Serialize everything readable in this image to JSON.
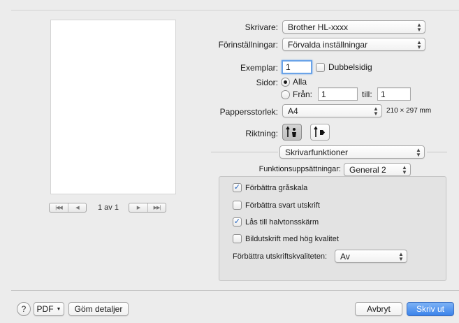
{
  "preview": {
    "page_indicator": "1 av 1",
    "first_icon": "|◀◀",
    "prev_icon": "◀",
    "next_icon": "▶",
    "last_icon": "▶▶|"
  },
  "printer": {
    "label": "Skrivare:",
    "value": "Brother HL-xxxx"
  },
  "presets": {
    "label": "Förinställningar:",
    "value": "Förvalda inställningar"
  },
  "copies": {
    "label": "Exemplar:",
    "value": "1",
    "duplex_label": "Dubbelsidig",
    "duplex_checked": false
  },
  "pages": {
    "label": "Sidor:",
    "all_label": "Alla",
    "from_label": "Från:",
    "from_value": "1",
    "to_label": "till:",
    "to_value": "1",
    "selected": "all"
  },
  "paper_size": {
    "label": "Pappersstorlek:",
    "value": "A4",
    "dimensions": "210 × 297 mm"
  },
  "orientation": {
    "label": "Riktning:",
    "selected": "portrait"
  },
  "section": {
    "value": "Skrivarfunktioner"
  },
  "feature_sets": {
    "label": "Funktionsuppsättningar:",
    "value": "General 2"
  },
  "options": [
    {
      "label": "Förbättra gråskala",
      "checked": true
    },
    {
      "label": "Förbättra svart utskrift",
      "checked": false
    },
    {
      "label": "Lås till halvtonsskärm",
      "checked": true
    },
    {
      "label": "Bildutskrift med hög kvalitet",
      "checked": false
    }
  ],
  "quality": {
    "label": "Förbättra utskriftskvaliteten:",
    "value": "Av"
  },
  "footer": {
    "help_label": "?",
    "pdf_label": "PDF",
    "hide_details_label": "Göm detaljer",
    "cancel_label": "Avbryt",
    "print_label": "Skriv ut"
  },
  "colors": {
    "accent": "#3b83ea",
    "check": "#1c5fbd"
  }
}
